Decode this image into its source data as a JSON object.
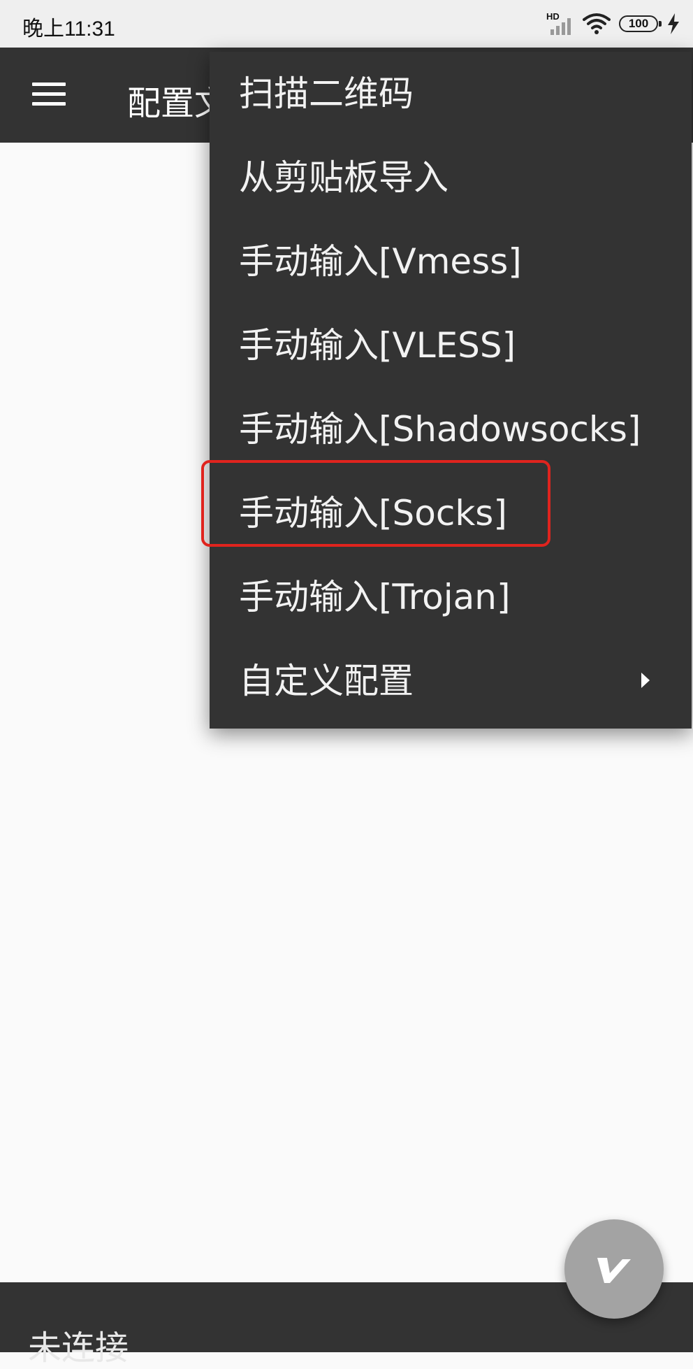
{
  "status_bar": {
    "time": "晚上11:31",
    "network_label": "HD",
    "battery": "100",
    "icons": [
      "signal-icon",
      "wifi-icon",
      "battery-icon",
      "charging-icon"
    ]
  },
  "app_bar": {
    "title": "配置文件",
    "menu_icon": "hamburger-icon"
  },
  "menu": {
    "items": [
      {
        "label": "扫描二维码"
      },
      {
        "label": "从剪贴板导入"
      },
      {
        "label": "手动输入[Vmess]"
      },
      {
        "label": "手动输入[VLESS]"
      },
      {
        "label": "手动输入[Shadowsocks]"
      },
      {
        "label": "手动输入[Socks]",
        "highlighted": true
      },
      {
        "label": "手动输入[Trojan]"
      },
      {
        "label": "自定义配置",
        "has_submenu": true
      }
    ]
  },
  "bottom_bar": {
    "status": "未连接"
  },
  "fab": {
    "icon": "v-logo-icon"
  },
  "colors": {
    "app_bar": "#333333",
    "menu": "#333333",
    "background": "#fafafa",
    "highlight": "#e0241e",
    "fab": "#a3a3a3"
  }
}
